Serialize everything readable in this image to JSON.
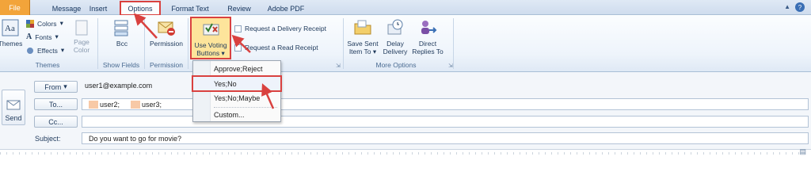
{
  "tabs": [
    "File",
    "Message",
    "Insert",
    "Options",
    "Format Text",
    "Review",
    "Adobe PDF"
  ],
  "ribbon": {
    "themes": {
      "themes_label": "Themes",
      "colors": "Colors",
      "fonts": "Fonts",
      "effects": "Effects",
      "page_color_1": "Page",
      "page_color_2": "Color",
      "group": "Themes"
    },
    "show_fields": {
      "bcc": "Bcc",
      "group": "Show Fields"
    },
    "permission": {
      "button": "Permission",
      "group": "Permission"
    },
    "tracking": {
      "voting_1": "Use Voting",
      "voting_2": "Buttons",
      "delivery_receipt": "Request a Delivery Receipt",
      "read_receipt": "Request a Read Receipt"
    },
    "more_options": {
      "save_sent_1": "Save Sent",
      "save_sent_2": "Item To",
      "delay_1": "Delay",
      "delay_2": "Delivery",
      "direct_1": "Direct",
      "direct_2": "Replies To",
      "group": "More Options"
    }
  },
  "voting_menu": [
    "Approve;Reject",
    "Yes;No",
    "Yes;No;Maybe",
    "Custom..."
  ],
  "message": {
    "send": "Send",
    "from_label": "From",
    "from_value": "user1@example.com",
    "to_label": "To...",
    "to_recipients": [
      "user2;",
      "user3;"
    ],
    "cc_label": "Cc...",
    "subject_label": "Subject:",
    "subject_value": "Do you want to go for movie?"
  },
  "colors": {
    "accent": "#d9413f",
    "file_tab": "#f2a43a",
    "highlight": "#fde49b"
  }
}
